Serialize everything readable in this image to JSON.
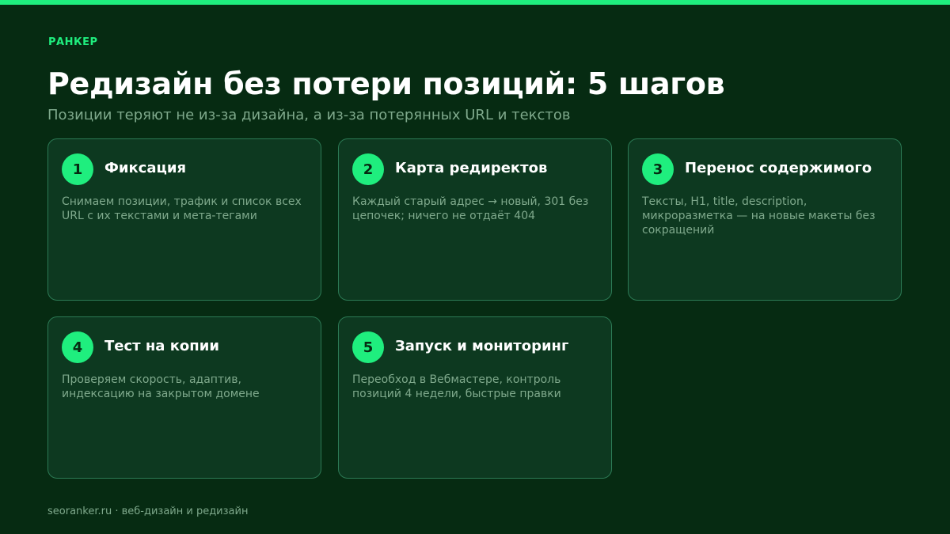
{
  "brand": "РАНКЕР",
  "title": "Редизайн без потери позиций: 5 шагов",
  "subtitle": "Позиции теряют не из-за дизайна, а из-за потерянных URL и текстов",
  "steps": [
    {
      "number": "1",
      "title": "Фиксация",
      "text": "Снимаем позиции, трафик и список всех URL с их текстами и мета-тегами"
    },
    {
      "number": "2",
      "title": "Карта редиректов",
      "text": "Каждый старый адрес → новый, 301 без цепочек; ничего не отдаёт 404"
    },
    {
      "number": "3",
      "title": "Перенос содержимого",
      "text": "Тексты, H1, title, description, микроразметка — на новые макеты без сокращений"
    },
    {
      "number": "4",
      "title": "Тест на копии",
      "text": "Проверяем скорость, адаптив, индексацию на закрытом домене"
    },
    {
      "number": "5",
      "title": "Запуск и мониторинг",
      "text": "Переобход в Вебмастере, контроль позиций 4 недели, быстрые правки"
    }
  ],
  "footer": "seoranker.ru · веб-дизайн и редизайн",
  "colors": {
    "background": "#062b12",
    "accent": "#1fee7e",
    "card": "#0d3920",
    "card_border": "#2c7a55",
    "muted_text": "#7fa98c"
  }
}
